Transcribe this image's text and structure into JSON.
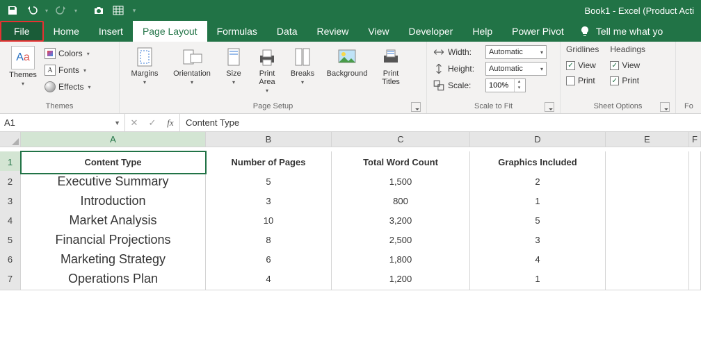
{
  "titlebar": {
    "title": "Book1  -  Excel (Product Acti"
  },
  "tabs": {
    "file": "File",
    "items": [
      "Home",
      "Insert",
      "Page Layout",
      "Formulas",
      "Data",
      "Review",
      "View",
      "Developer",
      "Help",
      "Power Pivot"
    ],
    "active": "Page Layout",
    "tell": "Tell me what yo"
  },
  "ribbon": {
    "themes": {
      "label": "Themes",
      "themes_btn": "Themes",
      "colors": "Colors",
      "fonts": "Fonts",
      "effects": "Effects"
    },
    "page_setup": {
      "label": "Page Setup",
      "margins": "Margins",
      "orientation": "Orientation",
      "size": "Size",
      "print_area": "Print\nArea",
      "breaks": "Breaks",
      "background": "Background",
      "print_titles": "Print\nTitles"
    },
    "scale": {
      "label": "Scale to Fit",
      "width": "Width:",
      "height": "Height:",
      "scale": "Scale:",
      "width_val": "Automatic",
      "height_val": "Automatic",
      "scale_val": "100%"
    },
    "sheet": {
      "label": "Sheet Options",
      "gridlines": "Gridlines",
      "headings": "Headings",
      "view": "View",
      "print": "Print"
    },
    "arrange_partial": "Fo"
  },
  "formula_bar": {
    "name": "A1",
    "value": "Content Type"
  },
  "columns": [
    "A",
    "B",
    "C",
    "D",
    "E",
    "F"
  ],
  "rows": [
    "1",
    "2",
    "3",
    "4",
    "5",
    "6",
    "7"
  ],
  "headers": [
    "Content Type",
    "Number of Pages",
    "Total Word Count",
    "Graphics Included"
  ],
  "data": [
    [
      "Executive Summary",
      "5",
      "1,500",
      "2"
    ],
    [
      "Introduction",
      "3",
      "800",
      "1"
    ],
    [
      "Market Analysis",
      "10",
      "3,200",
      "5"
    ],
    [
      "Financial Projections",
      "8",
      "2,500",
      "3"
    ],
    [
      "Marketing Strategy",
      "6",
      "1,800",
      "4"
    ],
    [
      "Operations Plan",
      "4",
      "1,200",
      "1"
    ]
  ]
}
